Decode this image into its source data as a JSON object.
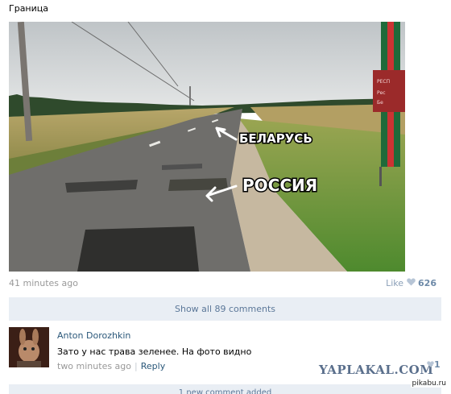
{
  "post": {
    "text": "Граница",
    "timestamp": "41 minutes ago",
    "like_label": "Like",
    "like_count": "626"
  },
  "photo": {
    "label_belarus": "БЕЛАРУСЬ",
    "label_russia": "РОССИЯ",
    "sign_text": [
      "РЕСП",
      "Б",
      "Рес",
      "Бе"
    ]
  },
  "comments_bar": {
    "show_all_label": "Show all 89 comments"
  },
  "comment": {
    "author": "Anton Dorozhkin",
    "text": "Зато у нас трава зеленее. На фото видно",
    "time": "two minutes ago",
    "reply_label": "Reply",
    "like_count": "1"
  },
  "new_comment_bar": {
    "label": "1 new comment added"
  },
  "watermark": {
    "text": "YAPLAKAL.COM"
  },
  "site_tag": {
    "text": "pikabu.ru"
  },
  "colors": {
    "link": "#2b587a",
    "muted": "#999999",
    "bar_bg": "#e9eef4",
    "like": "#6e8aa8"
  }
}
